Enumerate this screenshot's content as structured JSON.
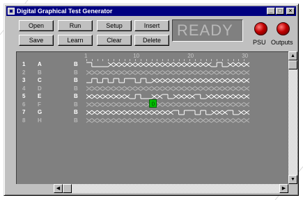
{
  "window": {
    "title": "Digital Graphical Test Generator"
  },
  "title_buttons": {
    "minimize": "_",
    "maximize": "□",
    "close": "×"
  },
  "toolbar": {
    "open": "Open",
    "run": "Run",
    "setup": "Setup",
    "insert": "Insert",
    "save": "Save",
    "learn": "Learn",
    "clear": "Clear",
    "delete": "Delete"
  },
  "status": {
    "text": "READY"
  },
  "indicators": {
    "psu": "PSU",
    "outputs": "Outputs"
  },
  "ruler": {
    "labels": [
      "1",
      "10",
      "20",
      "30"
    ]
  },
  "channels": [
    {
      "num": "1",
      "name": "A",
      "state": "B",
      "active": true
    },
    {
      "num": "2",
      "name": "B",
      "state": "B",
      "active": false
    },
    {
      "num": "3",
      "name": "C",
      "state": "B",
      "active": true
    },
    {
      "num": "4",
      "name": "D",
      "state": "B",
      "active": false
    },
    {
      "num": "5",
      "name": "E",
      "state": "B",
      "active": true
    },
    {
      "num": "6",
      "name": "F",
      "state": "B",
      "active": false
    },
    {
      "num": "7",
      "name": "G",
      "state": "B",
      "active": true
    },
    {
      "num": "8",
      "name": "H",
      "state": "B",
      "active": false
    }
  ],
  "cursor": {
    "label": "0"
  },
  "scroll_glyphs": {
    "up": "▲",
    "down": "▼",
    "left": "◀",
    "right": "▶"
  },
  "colors": {
    "title_bar": "#000080",
    "editor_bg": "#808080",
    "active_wave": "#ffffff",
    "inactive_wave": "#b8b8b8",
    "cursor": "#00c000",
    "led": "#c00000"
  }
}
